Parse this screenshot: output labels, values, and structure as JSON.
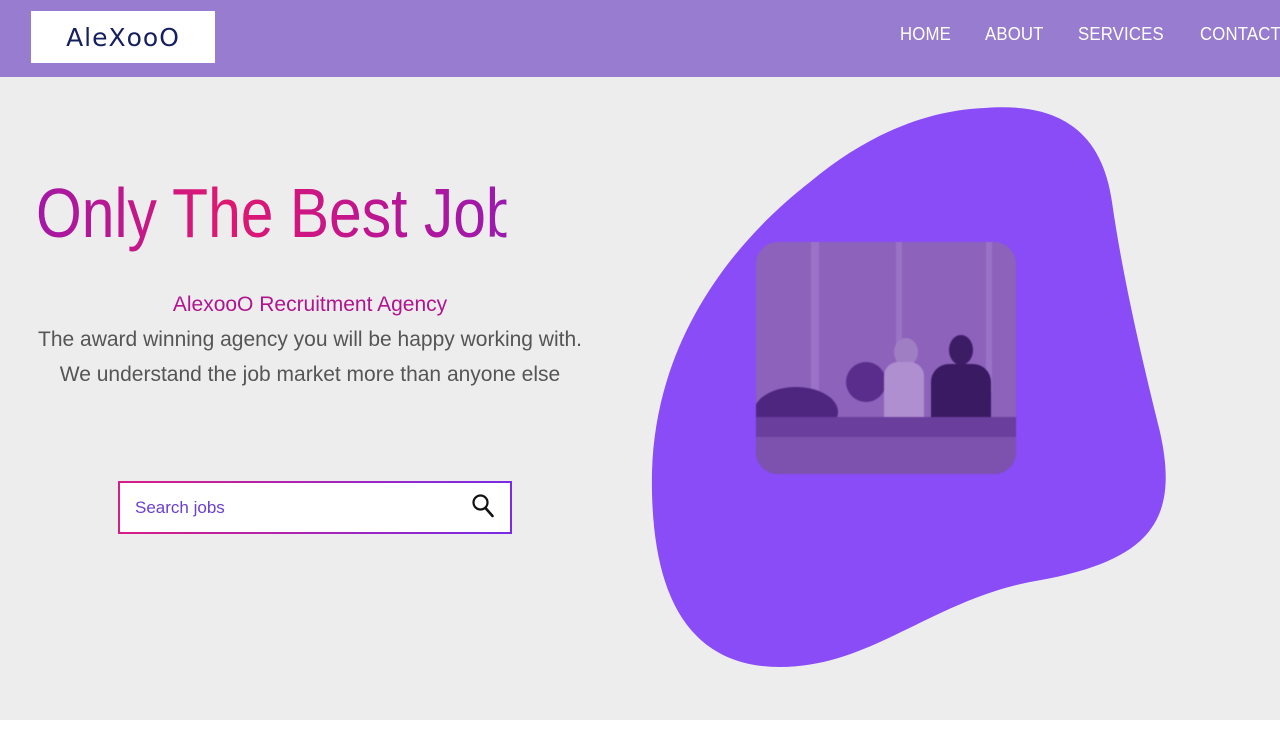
{
  "brand": {
    "logo_text": "AleXooO"
  },
  "nav": {
    "items": [
      {
        "label": "HOME"
      },
      {
        "label": "ABOUT"
      },
      {
        "label": "SERVICES"
      },
      {
        "label": "CONTACT"
      }
    ]
  },
  "hero": {
    "headline": "Only The Best Jobs",
    "agency_name": "AlexooO Recruitment Agency",
    "tagline_line1": "The award winning agency you will be happy working with.",
    "tagline_line2": "We understand the job market more than anyone else"
  },
  "search": {
    "placeholder": "Search jobs",
    "value": "",
    "icon": "search-icon"
  },
  "colors": {
    "navbar": "#977ccf",
    "hero_bg": "#eeedee",
    "blob": "#8a4cf7",
    "headline_gradient": [
      "#a317a6",
      "#e01870",
      "#9a1ab0"
    ],
    "agency_name": "#b0158f",
    "tagline": "#555555"
  }
}
